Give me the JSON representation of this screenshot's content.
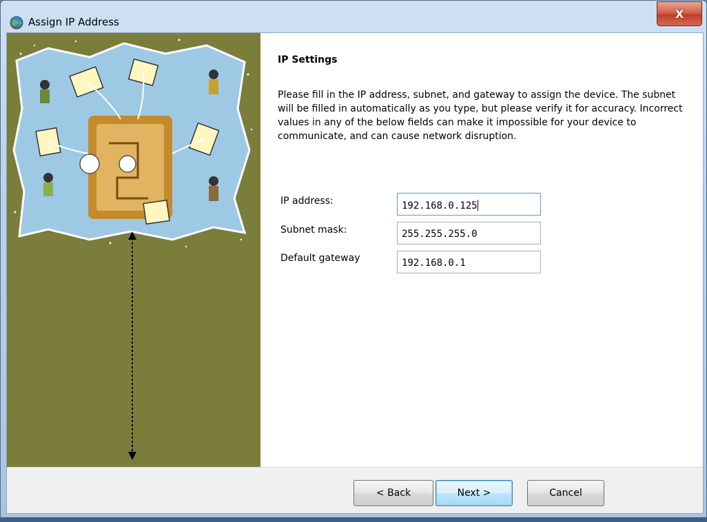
{
  "window": {
    "title": "Assign IP Address",
    "close_label": "X"
  },
  "page": {
    "heading": "IP Settings",
    "description": "Please fill in the IP address, subnet, and gateway to assign the device. The subnet will be filled in automatically as you type, but please verify it for accuracy.  Incorrect values in any of the below fields can make it impossible for your device to communicate, and can cause network disruption."
  },
  "fields": [
    {
      "label": "IP address:",
      "value": "192.168.0.125"
    },
    {
      "label": "Subnet mask:",
      "value": "255.255.255.0"
    },
    {
      "label": "Default gateway",
      "value": "192.168.0.1"
    }
  ],
  "buttons": {
    "back": "< Back",
    "next": "Next >",
    "cancel": "Cancel"
  },
  "colors": {
    "banner_background": "#7b7d3b",
    "close_button": "#c0402a",
    "default_button_border": "#3c7fb1"
  },
  "icons": {
    "title": "network-globe-icon",
    "banner": "wizard-illustration"
  }
}
